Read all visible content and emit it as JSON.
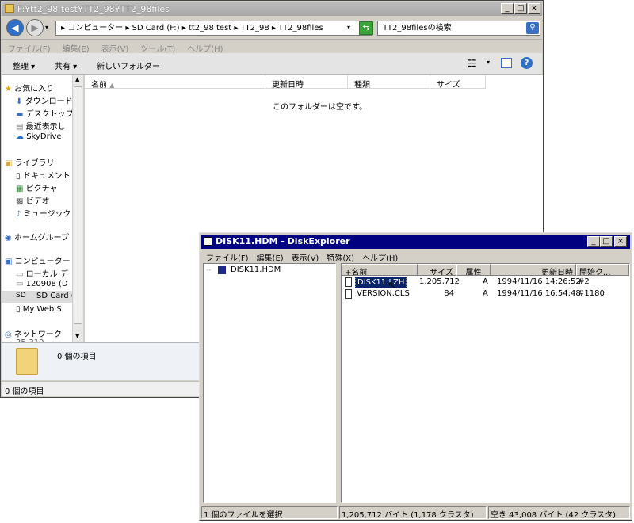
{
  "explorer": {
    "title": "F:¥tt2_98 test¥TT2_98¥TT2_98files",
    "address": "▸ コンピューター ▸ SD Card (F:) ▸ tt2_98 test ▸ TT2_98 ▸ TT2_98files",
    "search_placeholder": "TT2_98filesの検索",
    "menu": [
      "ファイル(F)",
      "編集(E)",
      "表示(V)",
      "ツール(T)",
      "ヘルプ(H)"
    ],
    "toolbar": {
      "organize": "整理 ▾",
      "share": "共有 ▾",
      "new_folder": "新しいフォルダー"
    },
    "nav": {
      "favorites": "お気に入り",
      "downloads": "ダウンロード",
      "desktop": "デスクトップ",
      "recent": "最近表示し",
      "skydrive": "SkyDrive",
      "libraries": "ライブラリ",
      "documents": "ドキュメント",
      "pictures": "ピクチャ",
      "videos": "ビデオ",
      "music": "ミュージック",
      "homegroup": "ホームグループ",
      "computer": "コンピューター",
      "local": "ローカル デ",
      "drive1": "120908 (D",
      "sdcard": "SD Card (",
      "myweb": "My Web S",
      "network": "ネットワーク",
      "network_sub": "25-310"
    },
    "columns": {
      "name": "名前",
      "modified": "更新日時",
      "type": "種類",
      "size": "サイズ"
    },
    "empty_message": "このフォルダーは空です。",
    "details_count": "0 個の項目",
    "status": "0 個の項目"
  },
  "diskexplorer": {
    "title": "DISK11.HDM - DiskExplorer",
    "menu": [
      "ファイル(F)",
      "編集(E)",
      "表示(V)",
      "特殊(X)",
      "ヘルプ(H)"
    ],
    "tree_root": "DISK11.HDM",
    "columns": {
      "name": "+名前",
      "size": "サイズ",
      "attr": "属性",
      "modified": "更新日時",
      "cluster": "開始ク..."
    },
    "files": [
      {
        "name": "DISK11.LZH",
        "size": "1,205,712",
        "attr": "A",
        "modified": "1994/11/16 14:26:52",
        "cluster": "#2"
      },
      {
        "name": "VERSION.CLS",
        "size": "84",
        "attr": "A",
        "modified": "1994/11/16 16:54:48",
        "cluster": "#1180"
      }
    ],
    "status": {
      "selection": "1 個のファイルを選択",
      "size": "1,205,712 バイト (1,178 クラスタ)",
      "free": "空き 43,008 バイト (42 クラスタ)"
    }
  }
}
